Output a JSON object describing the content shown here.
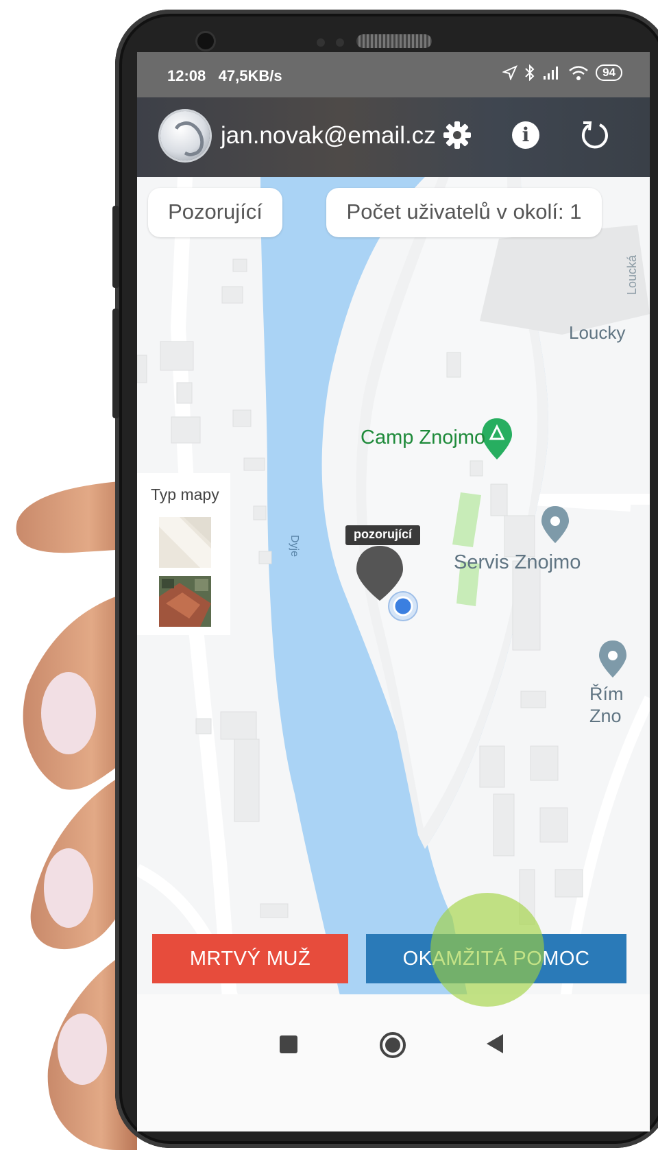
{
  "status_bar": {
    "time": "12:08",
    "network_speed": "47,5KB/s",
    "battery_level": "94",
    "icons": [
      "location-arrow-icon",
      "bluetooth-icon",
      "signal-icon",
      "wifi-icon",
      "battery-icon"
    ]
  },
  "header": {
    "email": "jan.novak@email.cz",
    "icons": [
      "settings-gear-icon",
      "info-icon",
      "refresh-icon"
    ]
  },
  "chips": {
    "role": "Pozorující",
    "nearby_users": "Počet uživatelů v okolí: 1"
  },
  "map_type": {
    "title": "Typ mapy",
    "options": [
      "map-thumbnail",
      "satellite-thumbnail"
    ]
  },
  "map": {
    "pin_label": "pozorující",
    "river_label": "Dyje",
    "camp_label": "Camp Znojmo",
    "service_label": "Servis Znojmo",
    "edge_label_1": "Loucky",
    "edge_label_2_line1": "Řím",
    "edge_label_2_line2": "Zno",
    "street_label": "Loucká"
  },
  "actions": {
    "dead_man": "MRTVÝ MUŽ",
    "instant_help": "OKAMŽITÁ POMOC"
  },
  "colors": {
    "dead_man_button": "#e74c3c",
    "instant_help_button": "#2a7ab8",
    "water": "#aad3f5",
    "camp_green": "#1e8a3a"
  },
  "navbar": {
    "icons": [
      "recents-square-icon",
      "home-circle-icon",
      "back-triangle-icon"
    ]
  }
}
